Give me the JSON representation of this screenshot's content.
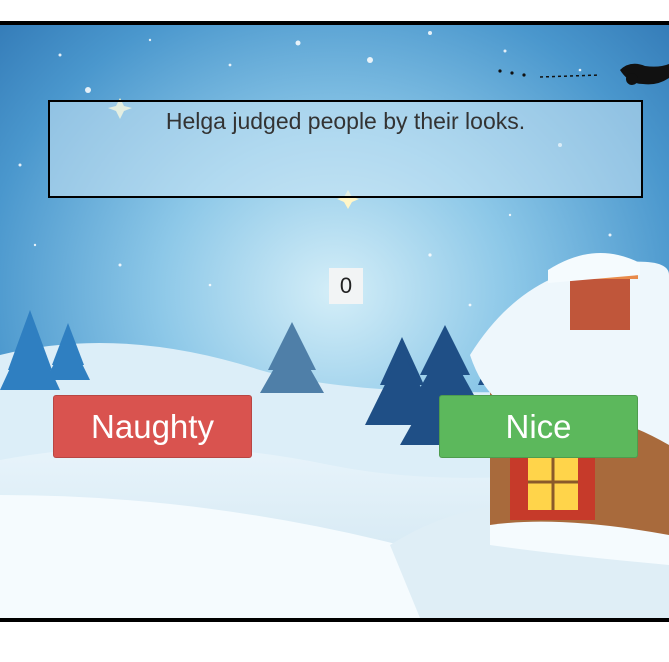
{
  "game": {
    "statement": "Helga judged people by their looks.",
    "score": "0",
    "naughty_label": "Naughty",
    "nice_label": "Nice"
  },
  "colors": {
    "naughty": "#d9534f",
    "nice": "#5cb85c",
    "sky_top": "#2a6fae",
    "sky_glow": "#c9e8f6",
    "snow": "#f5fbfe"
  }
}
